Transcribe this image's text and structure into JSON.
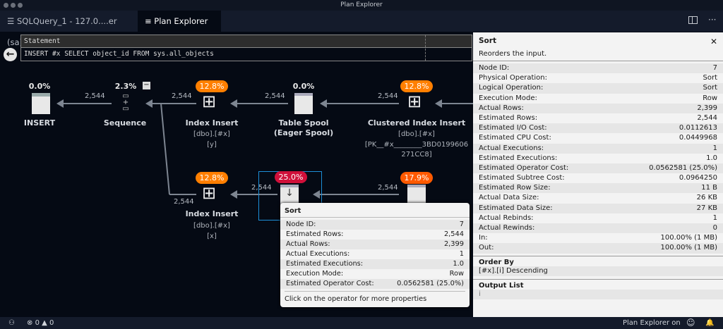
{
  "window": {
    "title": "Plan Explorer"
  },
  "tabs": [
    {
      "label": "SQLQuery_1 - 127.0....er (sa)",
      "icon": "database-icon"
    },
    {
      "label": "Plan Explorer",
      "icon": "document-icon"
    }
  ],
  "statement": {
    "header": "Statement",
    "text": "INSERT #x SELECT object_id FROM sys.all_objects"
  },
  "nodes": {
    "insert": {
      "pct": "0.0%",
      "name": "INSERT"
    },
    "sequence": {
      "pct": "2.3%",
      "name": "Sequence"
    },
    "index_insert_y": {
      "pct": "12.8%",
      "name": "Index Insert",
      "sub1": "[dbo].[#x]",
      "sub2": "[y]"
    },
    "table_spool": {
      "pct": "0.0%",
      "name": "Table Spool",
      "name2": "(Eager Spool)"
    },
    "clustered": {
      "pct": "12.8%",
      "name": "Clustered Index Insert",
      "sub1": "[dbo].[#x]",
      "sub2": "[PK__#x________3BD0199606",
      "sub3": "271CC8]"
    },
    "index_insert_x": {
      "pct": "12.8%",
      "name": "Index Insert",
      "sub1": "[dbo].[#x]",
      "sub2": "[x]"
    },
    "sort": {
      "pct": "25.0%"
    },
    "spool2": {
      "pct": "17.9%"
    }
  },
  "rows": "2,544",
  "colors": {
    "orange": "#ff7f00",
    "red": "#d0103a",
    "select": "#1d8fd8"
  },
  "tooltip": {
    "title": "Sort",
    "rows": [
      [
        "Node ID:",
        "7"
      ],
      [
        "Estimated Rows:",
        "2,544"
      ],
      [
        "Actual Rows:",
        "2,399"
      ],
      [
        "Actual Executions:",
        "1"
      ],
      [
        "Estimated Executions:",
        "1.0"
      ],
      [
        "Execution Mode:",
        "Row"
      ],
      [
        "Estimated Operator Cost:",
        "0.0562581 (25.0%)"
      ]
    ],
    "footer": "Click on the operator for more properties"
  },
  "panel": {
    "title": "Sort",
    "desc": "Reorders the input.",
    "rows": [
      [
        "Node ID:",
        "7"
      ],
      [
        "Physical Operation:",
        "Sort"
      ],
      [
        "Logical Operation:",
        "Sort"
      ],
      [
        "Execution Mode:",
        "Row"
      ],
      [
        "Actual Rows:",
        "2,399"
      ],
      [
        "Estimated Rows:",
        "2,544"
      ],
      [
        "Estimated I/O Cost:",
        "0.0112613"
      ],
      [
        "Estimated CPU Cost:",
        "0.0449968"
      ],
      [
        "Actual Executions:",
        "1"
      ],
      [
        "Estimated Executions:",
        "1.0"
      ],
      [
        "Estimated Operator Cost:",
        "0.0562581 (25.0%)"
      ],
      [
        "Estimated Subtree Cost:",
        "0.0964250"
      ],
      [
        "Estimated Row Size:",
        "11 B"
      ],
      [
        "Actual Data Size:",
        "26 KB"
      ],
      [
        "Estimated Data Size:",
        "27 KB"
      ],
      [
        "Actual Rebinds:",
        "1"
      ],
      [
        "Actual Rewinds:",
        "0"
      ],
      [
        "In:",
        "100.00% (1 MB)"
      ],
      [
        "Out:",
        "100.00% (1 MB)"
      ]
    ],
    "order_by_label": "Order By",
    "order_by": "[#x].[i] Descending",
    "output_list_label": "Output List",
    "output_list": "i"
  },
  "status": {
    "errors": "0",
    "warnings": "0",
    "right_text": "Plan Explorer on"
  }
}
